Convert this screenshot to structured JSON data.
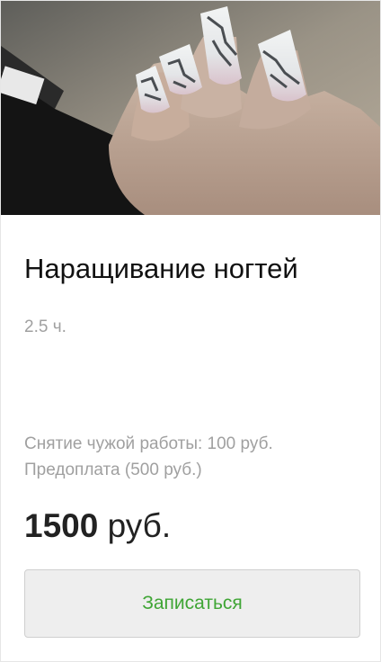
{
  "service": {
    "title": "Наращивание ногтей",
    "duration": "2.5 ч.",
    "notes": [
      "Снятие чужой работы: 100 руб.",
      "Предоплата (500 руб.)"
    ],
    "price_amount": "1500",
    "price_currency": "руб.",
    "book_label": "Записаться"
  },
  "colors": {
    "accent": "#3fa535",
    "muted_text": "#a0a0a0",
    "button_bg": "#eeeeee"
  }
}
